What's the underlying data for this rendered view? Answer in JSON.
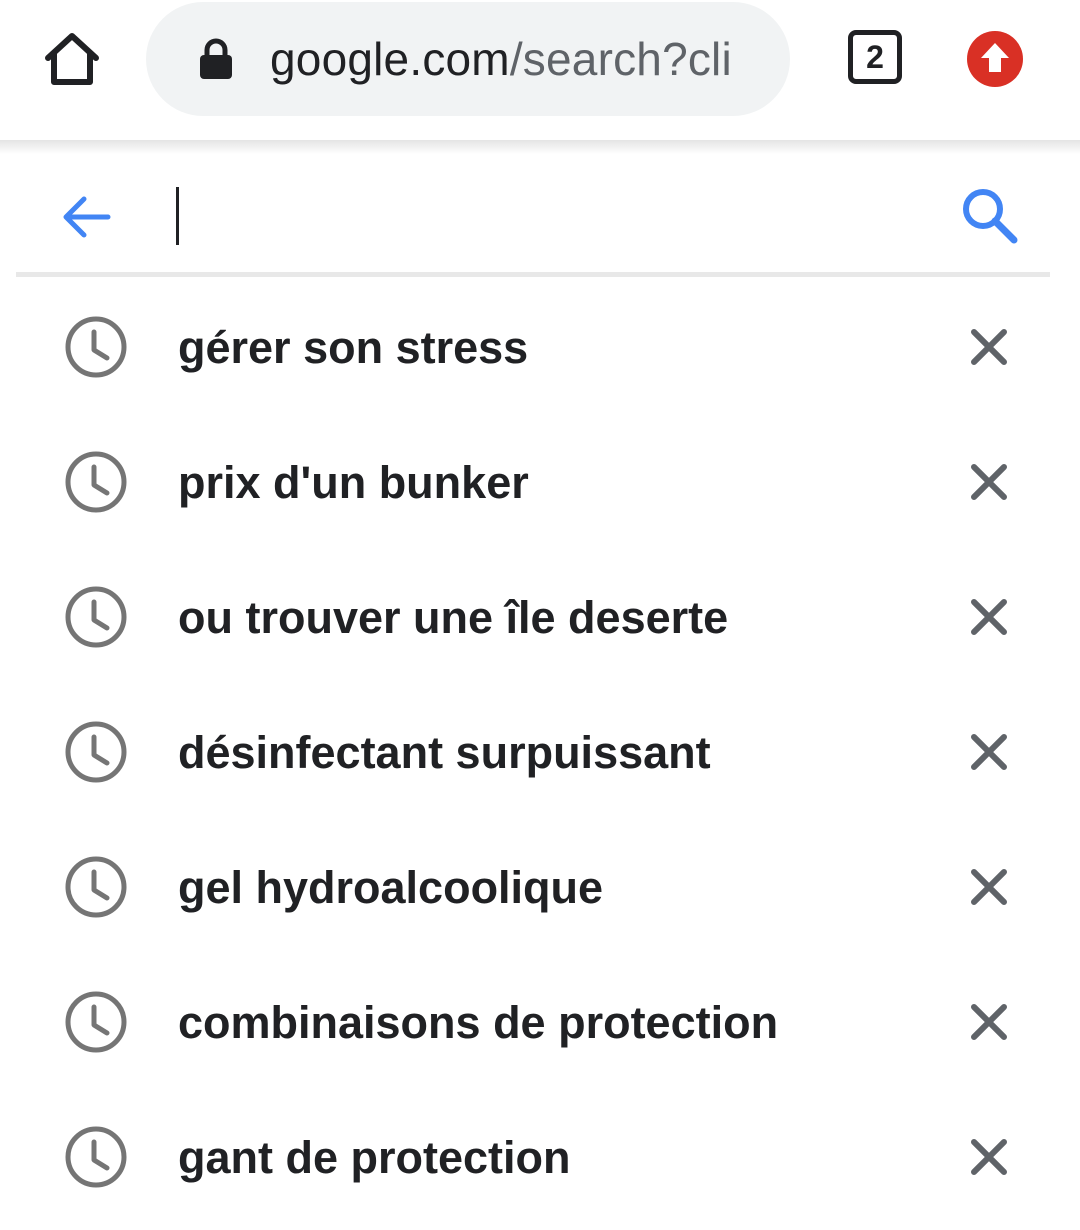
{
  "browser": {
    "url_primary": "google.com",
    "url_secondary": "/search?cli",
    "tab_count": "2",
    "icons": {
      "home": "home-icon",
      "lock": "lock-icon",
      "update": "update-arrow-icon"
    },
    "colors": {
      "update_badge": "#d93025",
      "omnibox_bg": "#f1f3f4"
    }
  },
  "search": {
    "value": "",
    "icons": {
      "back": "arrow-left-icon",
      "submit": "search-icon"
    },
    "colors": {
      "accent": "#4285f4"
    }
  },
  "suggestions": [
    {
      "text": "gérer son stress"
    },
    {
      "text": "prix d'un bunker"
    },
    {
      "text": "ou trouver une île deserte"
    },
    {
      "text": "désinfectant surpuissant"
    },
    {
      "text": "gel hydroalcoolique"
    },
    {
      "text": "combinaisons de protection"
    },
    {
      "text": "gant de protection"
    }
  ],
  "suggestion_icons": {
    "leading": "history-clock-icon",
    "trailing": "close-icon"
  }
}
